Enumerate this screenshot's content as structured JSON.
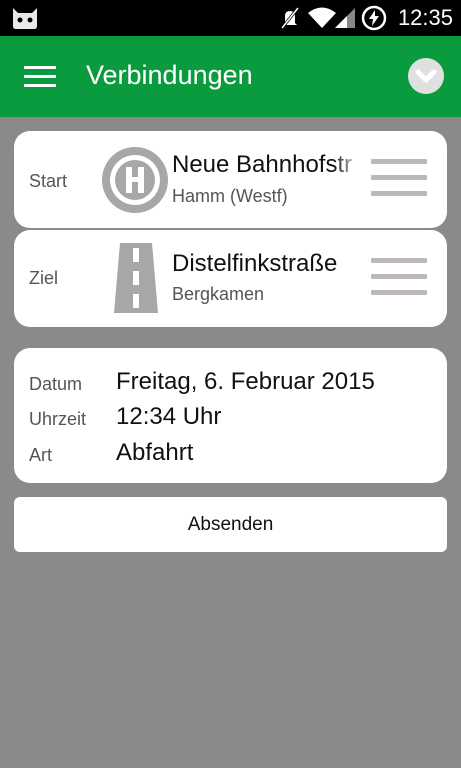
{
  "status_bar": {
    "time": "12:35",
    "icons": [
      "cyanogen-icon",
      "mute-icon",
      "wifi-icon",
      "signal-icon",
      "battery-charging-icon"
    ]
  },
  "app_bar": {
    "title": "Verbindungen",
    "menu_icon": "hamburger-menu-icon",
    "dropdown_icon": "chevron-down-icon",
    "color": "#0a9b3f"
  },
  "start": {
    "label": "Start",
    "icon": "bus-stop-h-icon",
    "name": "Neue Bahnhofstr",
    "city": "Hamm (Westf)",
    "handle_icon": "drag-handle-icon"
  },
  "ziel": {
    "label": "Ziel",
    "icon": "road-icon",
    "name": "Distelfinkstraße",
    "city": "Bergkamen",
    "handle_icon": "drag-handle-icon"
  },
  "datetime": {
    "date_label": "Datum",
    "date_value": "Freitag, 6. Februar 2015",
    "time_label": "Uhrzeit",
    "time_value": "12:34 Uhr",
    "type_label": "Art",
    "type_value": "Abfahrt"
  },
  "submit": {
    "label": "Absenden"
  },
  "colors": {
    "background": "#8a8a8a",
    "card": "#ffffff",
    "icon_gray": "#a7a7a7"
  }
}
